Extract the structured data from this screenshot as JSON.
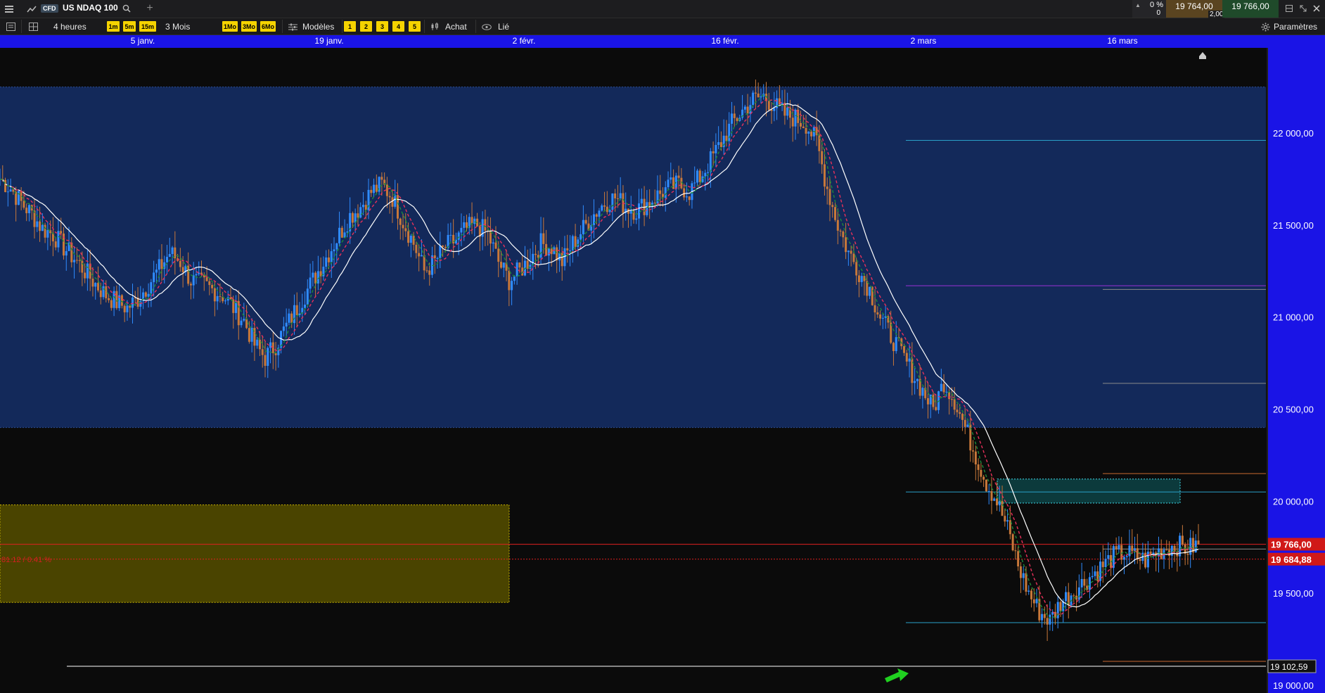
{
  "header": {
    "cfd_badge": "CFD",
    "symbol": "US NDAQ 100",
    "change_pct": "0 %",
    "change_val": "0",
    "bid": "19 764,00",
    "spread": "2,00",
    "ask": "19 766,00"
  },
  "toolbar": {
    "interval": "4 heures",
    "btn_1m": "1m",
    "btn_5m": "5m",
    "btn_15m": "15m",
    "period": "3 Mois",
    "btn_1mo": "1Mo",
    "btn_3mo": "3Mo",
    "btn_6mo": "6Mo",
    "models": "Modèles",
    "n1": "1",
    "n2": "2",
    "n3": "3",
    "n4": "4",
    "n5": "5",
    "buy": "Achat",
    "linked": "Lié",
    "settings": "Paramètres"
  },
  "dates": [
    "5 janv.",
    "19 janv.",
    "2 févr.",
    "16 févr.",
    "2 mars",
    "16 mars"
  ],
  "axis": {
    "ticks": [
      "22 000,00",
      "21 500,00",
      "21 000,00",
      "20 500,00",
      "20 000,00",
      "19 500,00",
      "19 000,00"
    ],
    "current_price": "19 766,00",
    "ma_price": "19 684,88",
    "low_label": "19 102,59",
    "zone_label": "81.12 / 0.41 %"
  },
  "chart_data": {
    "type": "candlestick",
    "xlabel": "",
    "ylabel": "",
    "ylim": [
      18950,
      22450
    ],
    "y_ticks": [
      19000,
      19500,
      20000,
      20500,
      21000,
      21500,
      22000
    ],
    "x_ticks": [
      "5 janv.",
      "19 janv.",
      "2 févr.",
      "16 févr.",
      "2 mars",
      "16 mars"
    ],
    "close_series_approx": [
      21750,
      21700,
      21620,
      21560,
      21480,
      21450,
      21380,
      21320,
      21250,
      21180,
      21120,
      21080,
      21050,
      21100,
      21180,
      21260,
      21350,
      21300,
      21200,
      21180,
      21150,
      21120,
      21050,
      20980,
      20850,
      20780,
      20850,
      20950,
      21050,
      21150,
      21250,
      21350,
      21450,
      21550,
      21600,
      21680,
      21720,
      21650,
      21520,
      21400,
      21250,
      21300,
      21380,
      21420,
      21480,
      21500,
      21450,
      21300,
      21200,
      21250,
      21320,
      21400,
      21380,
      21300,
      21400,
      21480,
      21560,
      21620,
      21650,
      21600,
      21580,
      21620,
      21660,
      21700,
      21720,
      21680,
      21760,
      21850,
      21950,
      22050,
      22120,
      22180,
      22200,
      22150,
      22100,
      22080,
      22050,
      21950,
      21700,
      21500,
      21350,
      21250,
      21150,
      21000,
      20900,
      20800,
      20700,
      20600,
      20500,
      20650,
      20550,
      20400,
      20250,
      20100,
      20000,
      19850,
      19650,
      19500,
      19400,
      19350,
      19450,
      19500,
      19550,
      19600,
      19650,
      19700,
      19720,
      19700,
      19680,
      19720,
      19750,
      19760,
      19740,
      19766
    ],
    "moving_averages": [
      {
        "color": "#ffffff",
        "style": "solid"
      },
      {
        "color": "#e8305a",
        "style": "dashed"
      },
      {
        "color": "#1e8a3a",
        "style": "dashed"
      }
    ],
    "horizontal_levels": [
      {
        "value": 22250,
        "color": "#1e5aa0"
      },
      {
        "value": 21960,
        "color": "#2aa0c8"
      },
      {
        "value": 21170,
        "color": "#9a30d8"
      },
      {
        "value": 20400,
        "color": "#1e5aa0"
      },
      {
        "value": 20050,
        "color": "#2aa0c8"
      },
      {
        "value": 19766,
        "color": "#e02020"
      },
      {
        "value": 19685,
        "color": "#e02020"
      },
      {
        "value": 19340,
        "color": "#2aa0c8"
      },
      {
        "value": 19103,
        "color": "#ffffff"
      }
    ],
    "zones": [
      {
        "from": 20400,
        "to": 22250,
        "color": "#13295a"
      },
      {
        "from": 19450,
        "to": 19980,
        "color": "#4a4400"
      }
    ]
  }
}
